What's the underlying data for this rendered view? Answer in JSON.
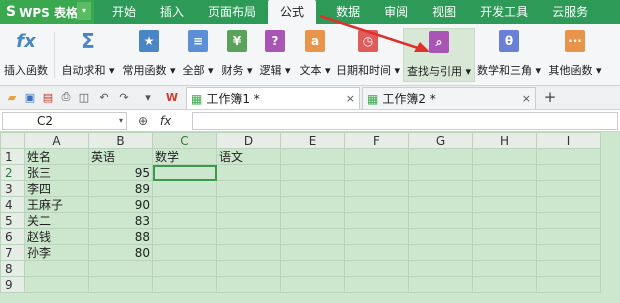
{
  "app": {
    "logo_text": "WPS 表格",
    "logo_mark": "S",
    "dropdown_glyph": "▾"
  },
  "tabs": [
    "开始",
    "插入",
    "页面布局",
    "公式",
    "数据",
    "审阅",
    "视图",
    "开发工具",
    "云服务"
  ],
  "active_tab": "公式",
  "ribbon": {
    "buttons": [
      {
        "label": "插入函数",
        "icon": "fx-icon",
        "glyph": "fx",
        "color": "#4a86c5"
      },
      {
        "label": "自动求和 ▾",
        "icon": "sum-icon",
        "glyph": "Σ",
        "color": "#4a86c5"
      },
      {
        "label": "常用函数 ▾",
        "icon": "star-book-icon",
        "glyph": "★",
        "color": "#4a86c5"
      },
      {
        "label": "全部 ▾",
        "icon": "all-book-icon",
        "glyph": "≡",
        "color": "#5b8fd6"
      },
      {
        "label": "财务 ▾",
        "icon": "finance-book-icon",
        "glyph": "¥",
        "color": "#5aa35a"
      },
      {
        "label": "逻辑 ▾",
        "icon": "logic-book-icon",
        "glyph": "?",
        "color": "#a855b5"
      },
      {
        "label": "文本 ▾",
        "icon": "text-book-icon",
        "glyph": "a",
        "color": "#e8944a"
      },
      {
        "label": "日期和时间 ▾",
        "icon": "datetime-book-icon",
        "glyph": "◷",
        "color": "#e15b5b"
      },
      {
        "label": "查找与引用 ▾",
        "icon": "lookup-book-icon",
        "glyph": "⌕",
        "color": "#a855b5"
      },
      {
        "label": "数学和三角 ▾",
        "icon": "math-book-icon",
        "glyph": "θ",
        "color": "#6a7fd6"
      },
      {
        "label": "其他函数 ▾",
        "icon": "other-book-icon",
        "glyph": "···",
        "color": "#e8944a"
      }
    ]
  },
  "toolbar": {
    "doc_tabs": [
      {
        "label": "工作簿1 *",
        "active": true
      },
      {
        "label": "工作簿2 *",
        "active": false
      }
    ],
    "tab_close": "×",
    "new_tab": "+",
    "wps_mark": "W"
  },
  "formula_bar": {
    "cell_ref": "C2",
    "fx_label": "fx",
    "value": ""
  },
  "sheet": {
    "columns": [
      "A",
      "B",
      "C",
      "D",
      "E",
      "F",
      "G",
      "H",
      "I"
    ],
    "selected_col": "C",
    "rows": [
      {
        "n": "1",
        "cells": [
          "姓名",
          "英语",
          "数学",
          "语文"
        ]
      },
      {
        "n": "2",
        "cells": [
          "张三",
          "95",
          "",
          ""
        ]
      },
      {
        "n": "3",
        "cells": [
          "李四",
          "89",
          "",
          ""
        ]
      },
      {
        "n": "4",
        "cells": [
          "王麻子",
          "90",
          "",
          ""
        ]
      },
      {
        "n": "5",
        "cells": [
          "关二",
          "83",
          "",
          ""
        ]
      },
      {
        "n": "6",
        "cells": [
          "赵钱",
          "88",
          "",
          ""
        ]
      },
      {
        "n": "7",
        "cells": [
          "孙李",
          "80",
          "",
          ""
        ]
      },
      {
        "n": "8",
        "cells": [
          "",
          "",
          "",
          ""
        ]
      },
      {
        "n": "9",
        "cells": [
          "",
          "",
          "",
          ""
        ]
      }
    ],
    "selected_row": "2"
  },
  "colors": {
    "titlebar": "#2d9b57",
    "accent": "#3aa84e",
    "arrow": "#e0302c",
    "grid_bg": "#cde7cf"
  }
}
